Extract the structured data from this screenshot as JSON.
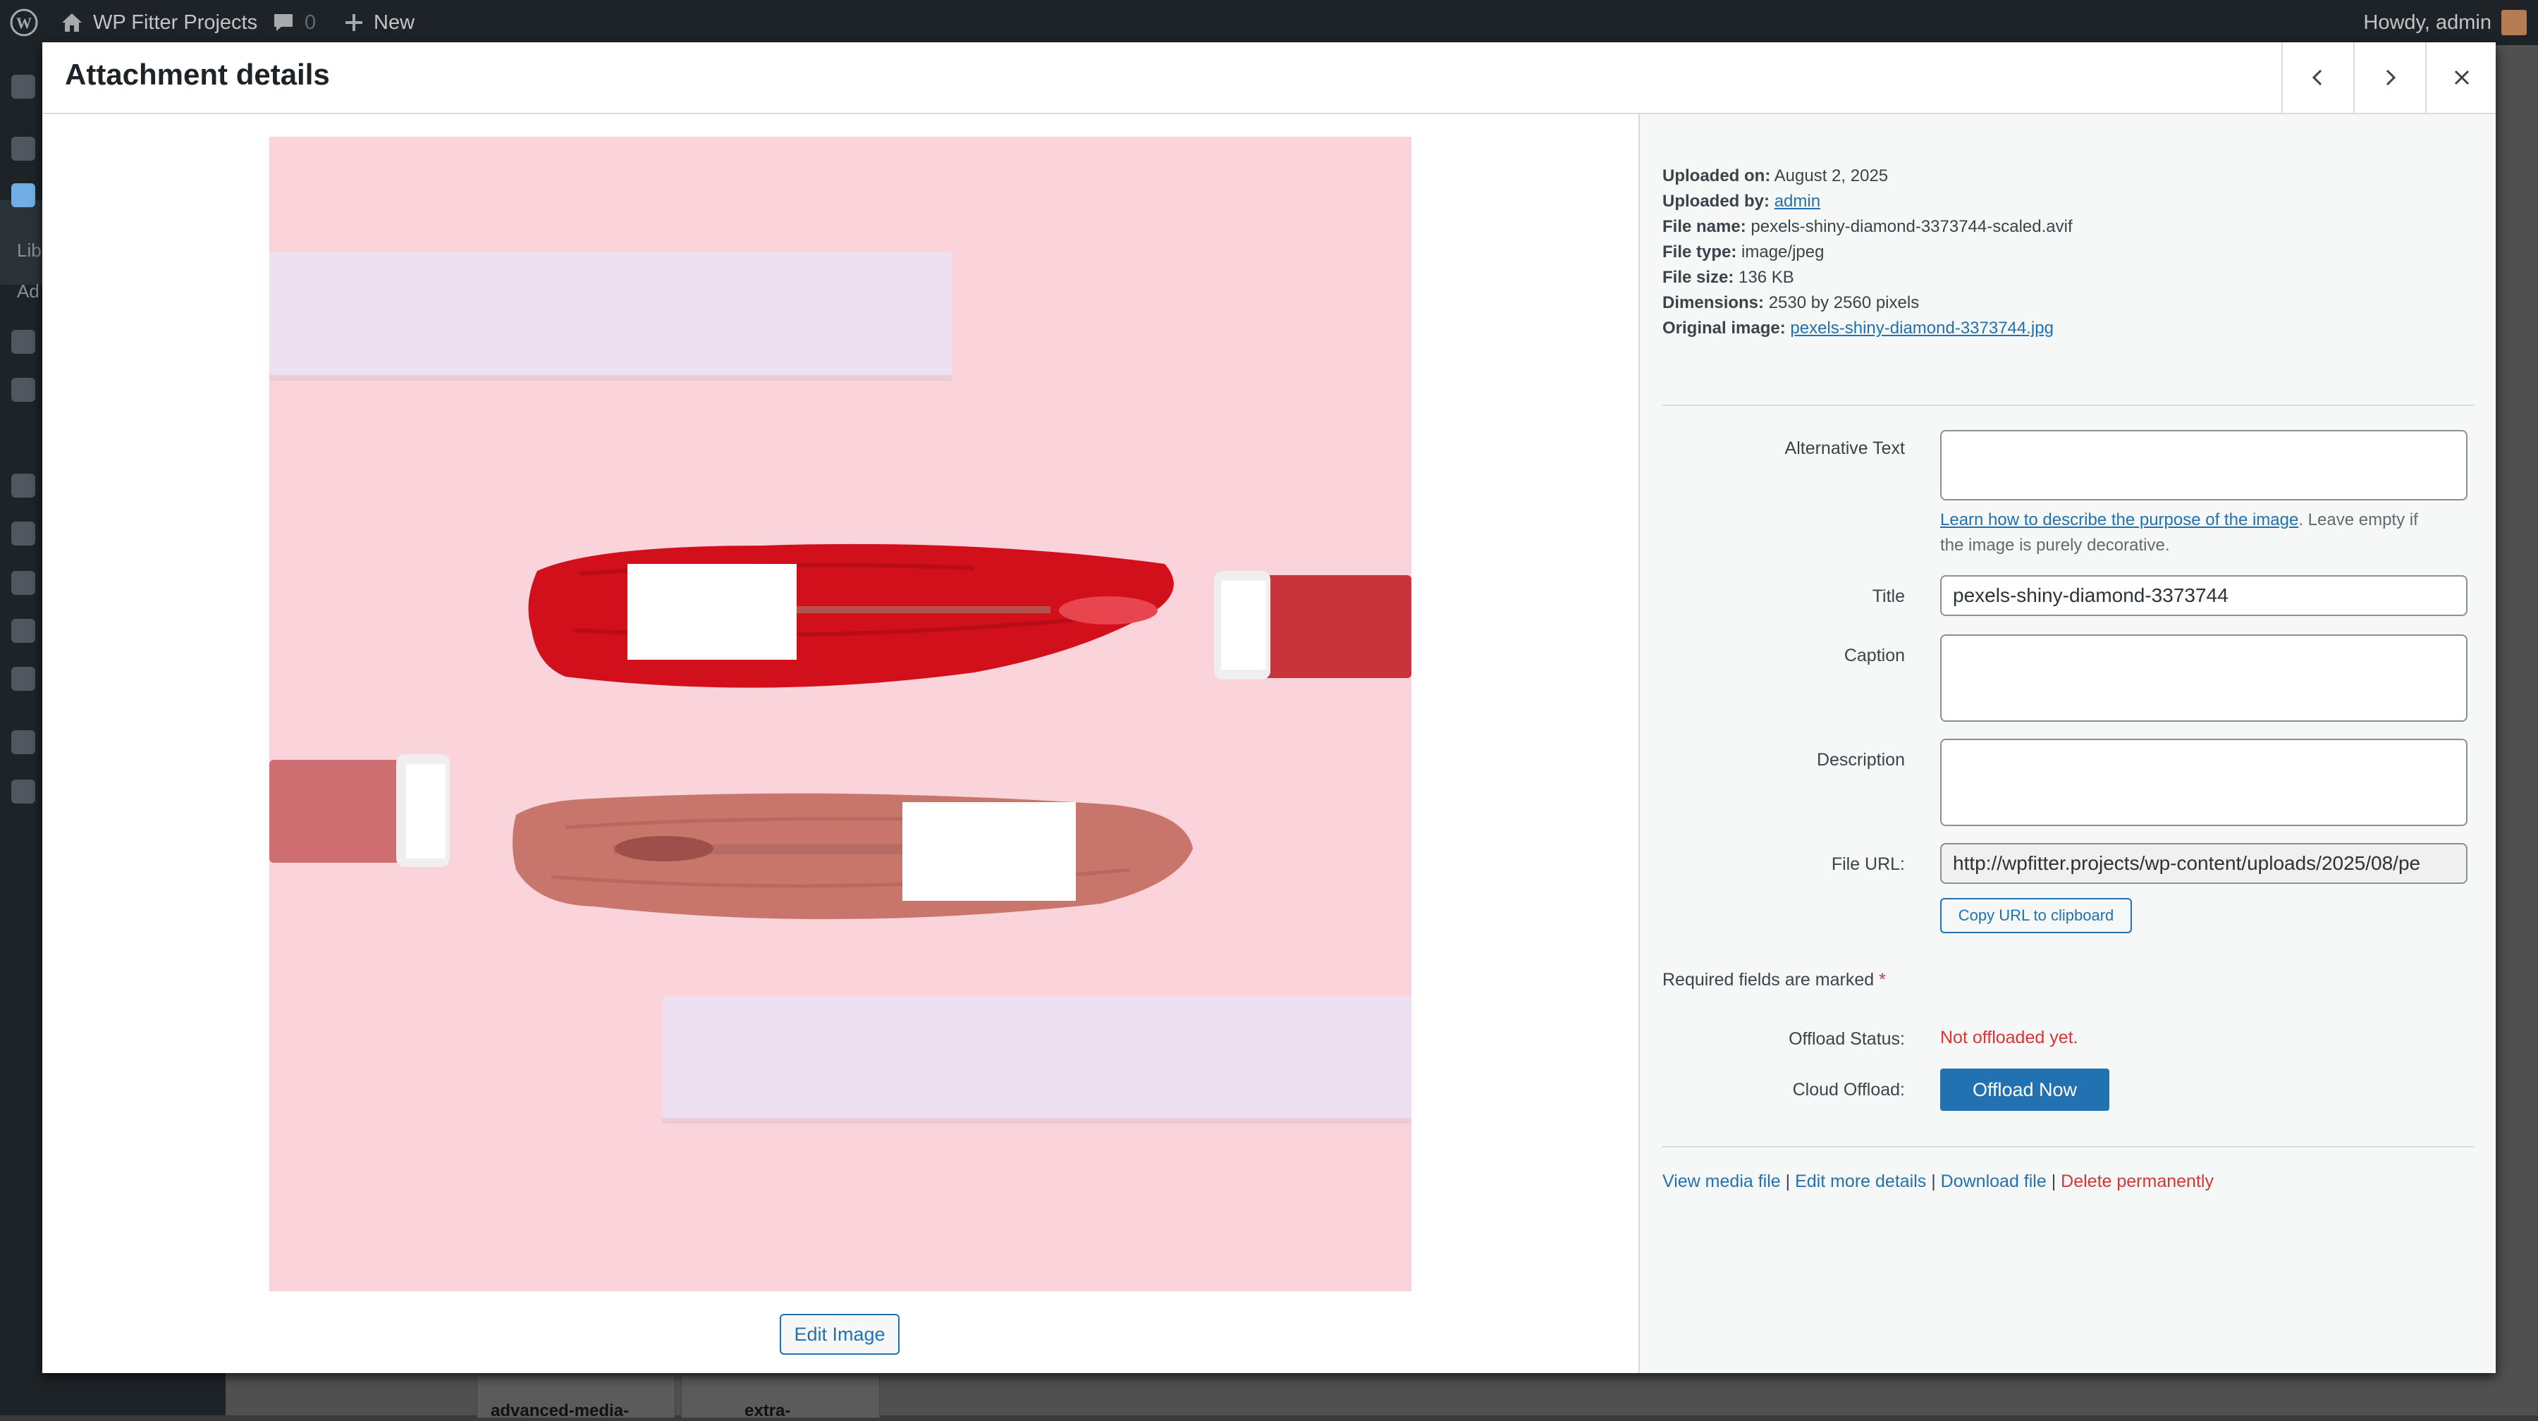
{
  "adminbar": {
    "site_name": "WP Fitter Projects",
    "comments_count": "0",
    "new_label": "New",
    "greeting": "Howdy, admin"
  },
  "sidebar": {
    "library_label": "Lib",
    "add_label": "Ad"
  },
  "background": {
    "card_labels": [
      "advanced-media-",
      "extra-"
    ]
  },
  "modal": {
    "title": "Attachment details",
    "edit_image_label": "Edit Image"
  },
  "details": {
    "uploaded_on_label": "Uploaded on:",
    "uploaded_on": "August 2, 2025",
    "uploaded_by_label": "Uploaded by:",
    "uploaded_by": "admin",
    "file_name_label": "File name:",
    "file_name": "pexels-shiny-diamond-3373744-scaled.avif",
    "file_type_label": "File type:",
    "file_type": "image/jpeg",
    "file_size_label": "File size:",
    "file_size": "136 KB",
    "dimensions_label": "Dimensions:",
    "dimensions": "2530 by 2560 pixels",
    "original_image_label": "Original image:",
    "original_image": "pexels-shiny-diamond-3373744.jpg"
  },
  "form": {
    "alt_text_label": "Alternative Text",
    "alt_text_value": "",
    "alt_help_link": "Learn how to describe the purpose of the image",
    "alt_help_text_1": ". Leave empty if",
    "alt_help_text_2": "the image is purely decorative.",
    "title_label": "Title",
    "title_value": "pexels-shiny-diamond-3373744",
    "caption_label": "Caption",
    "caption_value": "",
    "description_label": "Description",
    "description_value": "",
    "file_url_label": "File URL:",
    "file_url_value": "http://wpfitter.projects/wp-content/uploads/2025/08/pe",
    "copy_url_label": "Copy URL to clipboard",
    "required_text": "Required fields are marked",
    "required_star": "*",
    "offload_status_label": "Offload Status:",
    "offload_status_value": "Not offloaded yet.",
    "cloud_offload_label": "Cloud Offload:",
    "offload_button": "Offload Now"
  },
  "actions": {
    "view": "View media file",
    "edit": "Edit more details",
    "download": "Download file",
    "delete": "Delete permanently",
    "separator": " | "
  },
  "colors": {
    "accent": "#2271b1",
    "danger": "#d63638",
    "photo_background": "#fbd3da",
    "lip_red": "#d2101c",
    "lip_nude": "#c8766c"
  }
}
